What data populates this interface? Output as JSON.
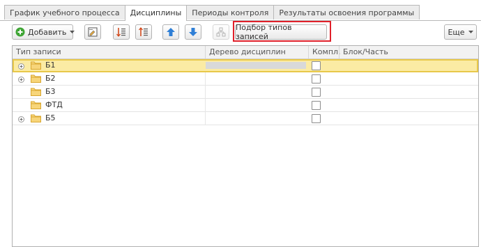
{
  "tabs": [
    {
      "label": "График учебного процесса",
      "active": false
    },
    {
      "label": "Дисциплины",
      "active": true
    },
    {
      "label": "Периоды контроля",
      "active": false
    },
    {
      "label": "Результаты освоения программы",
      "active": false
    }
  ],
  "toolbar": {
    "add_label": "Добавить",
    "pick_types_label": "Подбор типов записей",
    "more_label": "Еще"
  },
  "grid": {
    "columns": [
      "Тип записи",
      "Дерево дисциплин",
      "Компл.",
      "Блок/Часть"
    ],
    "rows": [
      {
        "label": "Б1",
        "expandable": true,
        "selected": true,
        "complex": false
      },
      {
        "label": "Б2",
        "expandable": true,
        "selected": false,
        "complex": false
      },
      {
        "label": "Б3",
        "expandable": false,
        "selected": false,
        "complex": false
      },
      {
        "label": "ФТД",
        "expandable": false,
        "selected": false,
        "complex": false
      },
      {
        "label": "Б5",
        "expandable": true,
        "selected": false,
        "complex": false
      }
    ]
  },
  "colors": {
    "selected_row": "#fbeba4",
    "highlight_box": "#e0202a",
    "add_icon": "#3fa535",
    "arrow_icon": "#2f7fd6",
    "folder": "#f3c24b"
  }
}
